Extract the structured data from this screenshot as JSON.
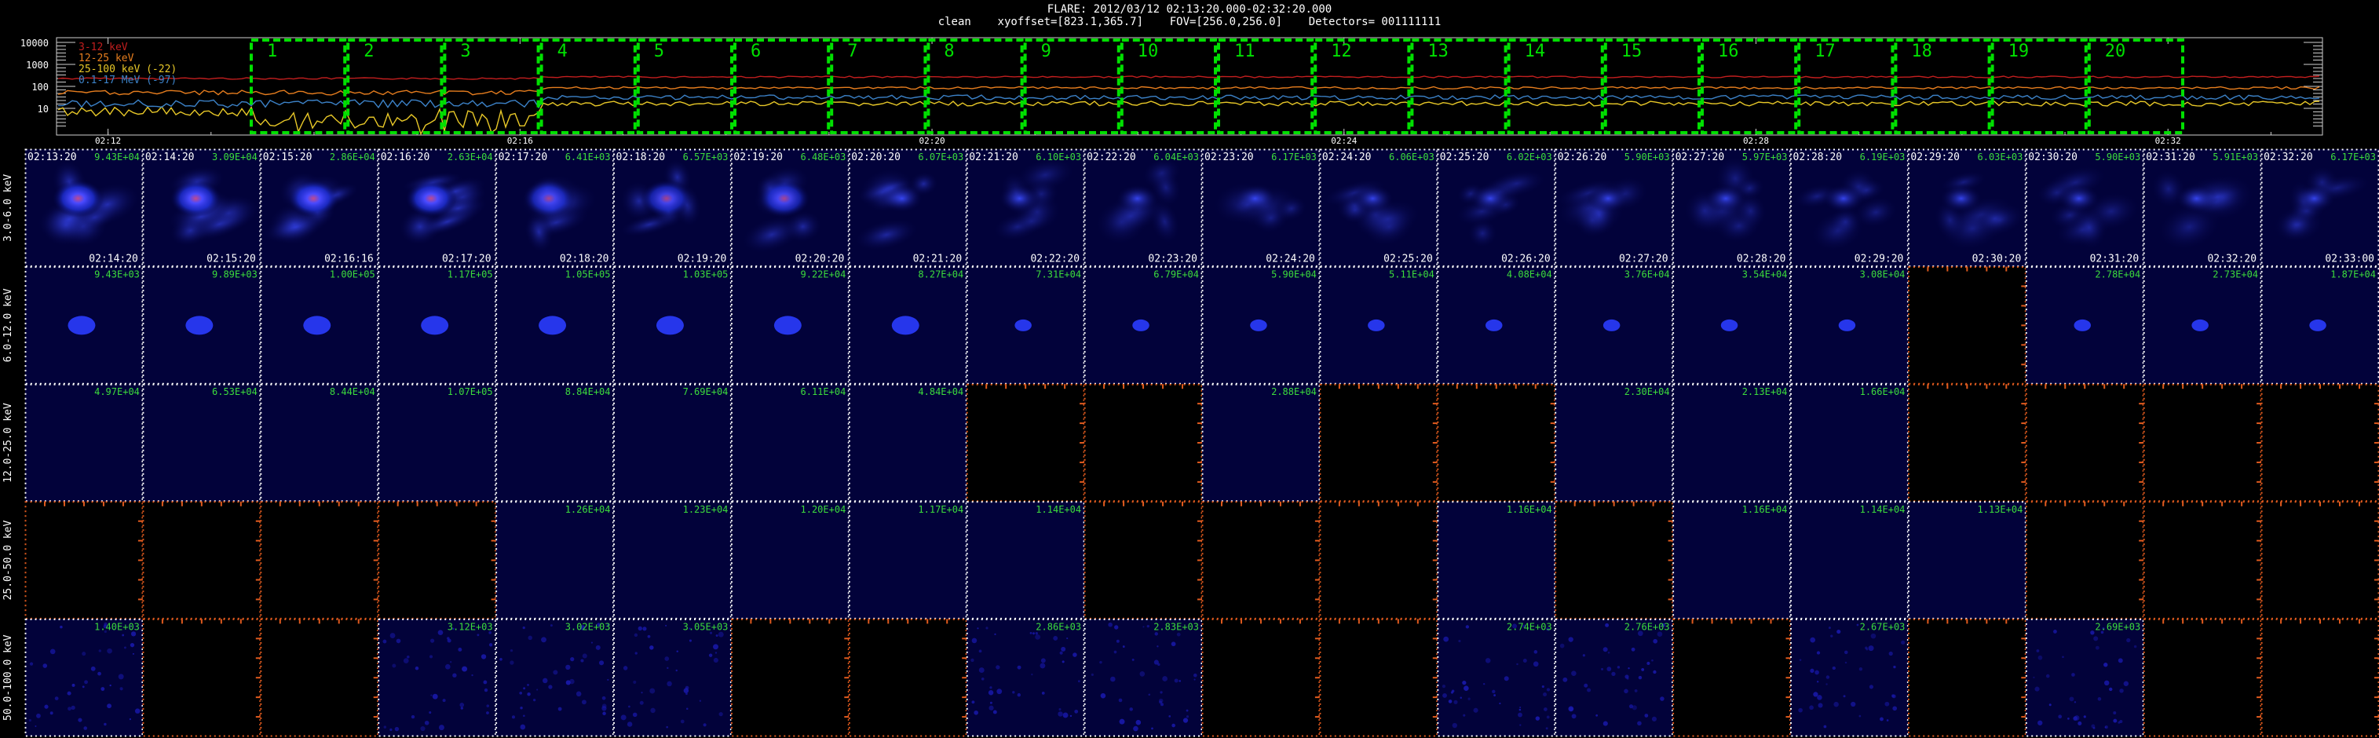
{
  "header": {
    "line1": "FLARE: 2012/03/12 02:13:20.000-02:32:20.000",
    "line2": "clean    xyoffset=[823.1,365.7]    FOV=[256.0,256.0]    Detectors= 001111111"
  },
  "lightcurve": {
    "ytick_labels": [
      "10000",
      "1000",
      "100",
      "10"
    ],
    "xtick_labels": [
      "02:12",
      "02:16",
      "02:20",
      "02:24",
      "02:28",
      "02:32"
    ],
    "legend": [
      {
        "label": "3-12 keV",
        "color": "#c21e1e"
      },
      {
        "label": "12-25 keV",
        "color": "#e67d1e"
      },
      {
        "label": "25-100 keV (-22)",
        "color": "#e8c828"
      },
      {
        "label": "0.1-17 MeV (-97)",
        "color": "#3c82c8"
      }
    ],
    "intervals": [
      "1",
      "2",
      "3",
      "4",
      "5",
      "6",
      "7",
      "8",
      "9",
      "10",
      "11",
      "12",
      "13",
      "14",
      "15",
      "16",
      "17",
      "18",
      "19",
      "20"
    ],
    "interval_color": "#00e000"
  },
  "energy_bands": [
    "3.0-6.0 keV",
    "6.0-12.0 keV",
    "12.0-25.0 keV",
    "25.0-50.0 keV",
    "50.0-100.0 keV"
  ],
  "time_starts": [
    "02:13:20",
    "02:14:20",
    "02:15:20",
    "02:16:20",
    "02:17:20",
    "02:18:20",
    "02:19:20",
    "02:20:20",
    "02:21:20",
    "02:22:20",
    "02:23:20",
    "02:24:20",
    "02:25:20",
    "02:26:20",
    "02:27:20",
    "02:28:20",
    "02:29:20",
    "02:30:20",
    "02:31:20",
    "02:32:20"
  ],
  "time_ends": [
    "02:14:20",
    "02:15:20",
    "02:16:16",
    "02:17:20",
    "02:18:20",
    "02:19:20",
    "02:20:20",
    "02:21:20",
    "02:22:20",
    "02:23:20",
    "02:24:20",
    "02:25:20",
    "02:26:20",
    "02:27:20",
    "02:28:20",
    "02:29:20",
    "02:30:20",
    "02:31:20",
    "02:32:20",
    "02:33:00"
  ],
  "cell_indices": [
    "1",
    "2",
    "3",
    "4",
    "5",
    "6",
    "7",
    "8",
    "9",
    "10",
    "11",
    "12",
    "13",
    "14",
    "15",
    "16",
    "17",
    "18",
    "19",
    "20"
  ],
  "image_values": [
    [
      "9.43E+04",
      "3.09E+04",
      "2.86E+04",
      "2.63E+04",
      "6.41E+03",
      "6.57E+03",
      "6.48E+03",
      "6.07E+03",
      "6.10E+03",
      "6.04E+03",
      "6.17E+03",
      "6.06E+03",
      "6.02E+03",
      "5.90E+03",
      "5.97E+03",
      "6.19E+03",
      "6.03E+03",
      "5.90E+03",
      "5.91E+03",
      "6.17E+03"
    ],
    [
      "9.43E+03",
      "9.89E+03",
      "1.00E+05",
      "1.17E+05",
      "1.05E+05",
      "1.03E+05",
      "9.22E+04",
      "8.27E+04",
      "7.31E+04",
      "6.79E+04",
      "5.90E+04",
      "5.11E+04",
      "4.08E+04",
      "3.76E+04",
      "3.54E+04",
      "3.08E+04",
      "",
      "2.78E+04",
      "2.73E+04",
      "1.87E+04"
    ],
    [
      "4.97E+04",
      "6.53E+04",
      "8.44E+04",
      "1.07E+05",
      "8.84E+04",
      "7.69E+04",
      "6.11E+04",
      "4.84E+04",
      "",
      "",
      "2.88E+04",
      "",
      "",
      "2.30E+04",
      "2.13E+04",
      "1.66E+04",
      "",
      "",
      "",
      ""
    ],
    [
      "",
      "",
      "",
      "",
      "1.26E+04",
      "1.23E+04",
      "1.20E+04",
      "1.17E+04",
      "1.14E+04",
      "",
      "",
      "",
      "1.16E+04",
      "",
      "1.16E+04",
      "1.14E+04",
      "1.13E+04",
      "",
      "",
      ""
    ],
    [
      "1.40E+03",
      "",
      "",
      "3.12E+03",
      "3.02E+03",
      "3.05E+03",
      "",
      "",
      "2.86E+03",
      "2.83E+03",
      "",
      "",
      "2.74E+03",
      "2.76E+03",
      "",
      "2.67E+03",
      "",
      "2.69E+03",
      "",
      ""
    ]
  ],
  "image_present": [
    [
      1,
      1,
      1,
      1,
      1,
      1,
      1,
      1,
      1,
      1,
      1,
      1,
      1,
      1,
      1,
      1,
      1,
      1,
      1,
      1
    ],
    [
      1,
      1,
      1,
      1,
      1,
      1,
      1,
      1,
      1,
      1,
      1,
      1,
      1,
      1,
      1,
      1,
      0,
      1,
      1,
      1
    ],
    [
      1,
      1,
      1,
      1,
      1,
      1,
      1,
      1,
      0,
      0,
      1,
      0,
      0,
      1,
      1,
      1,
      0,
      0,
      0,
      0
    ],
    [
      0,
      0,
      0,
      0,
      1,
      1,
      1,
      1,
      1,
      0,
      0,
      0,
      1,
      0,
      1,
      1,
      1,
      0,
      0,
      0
    ],
    [
      1,
      0,
      0,
      1,
      1,
      1,
      0,
      0,
      1,
      1,
      0,
      0,
      1,
      1,
      0,
      1,
      0,
      1,
      0,
      0
    ]
  ],
  "colors": {
    "value_text": "#3cdc3c",
    "index_text": "#3cdc3c",
    "present_border": "#ffffff",
    "empty_border": "#e05a1e",
    "image_bg": "#02023a",
    "source": "#2a3cff"
  }
}
